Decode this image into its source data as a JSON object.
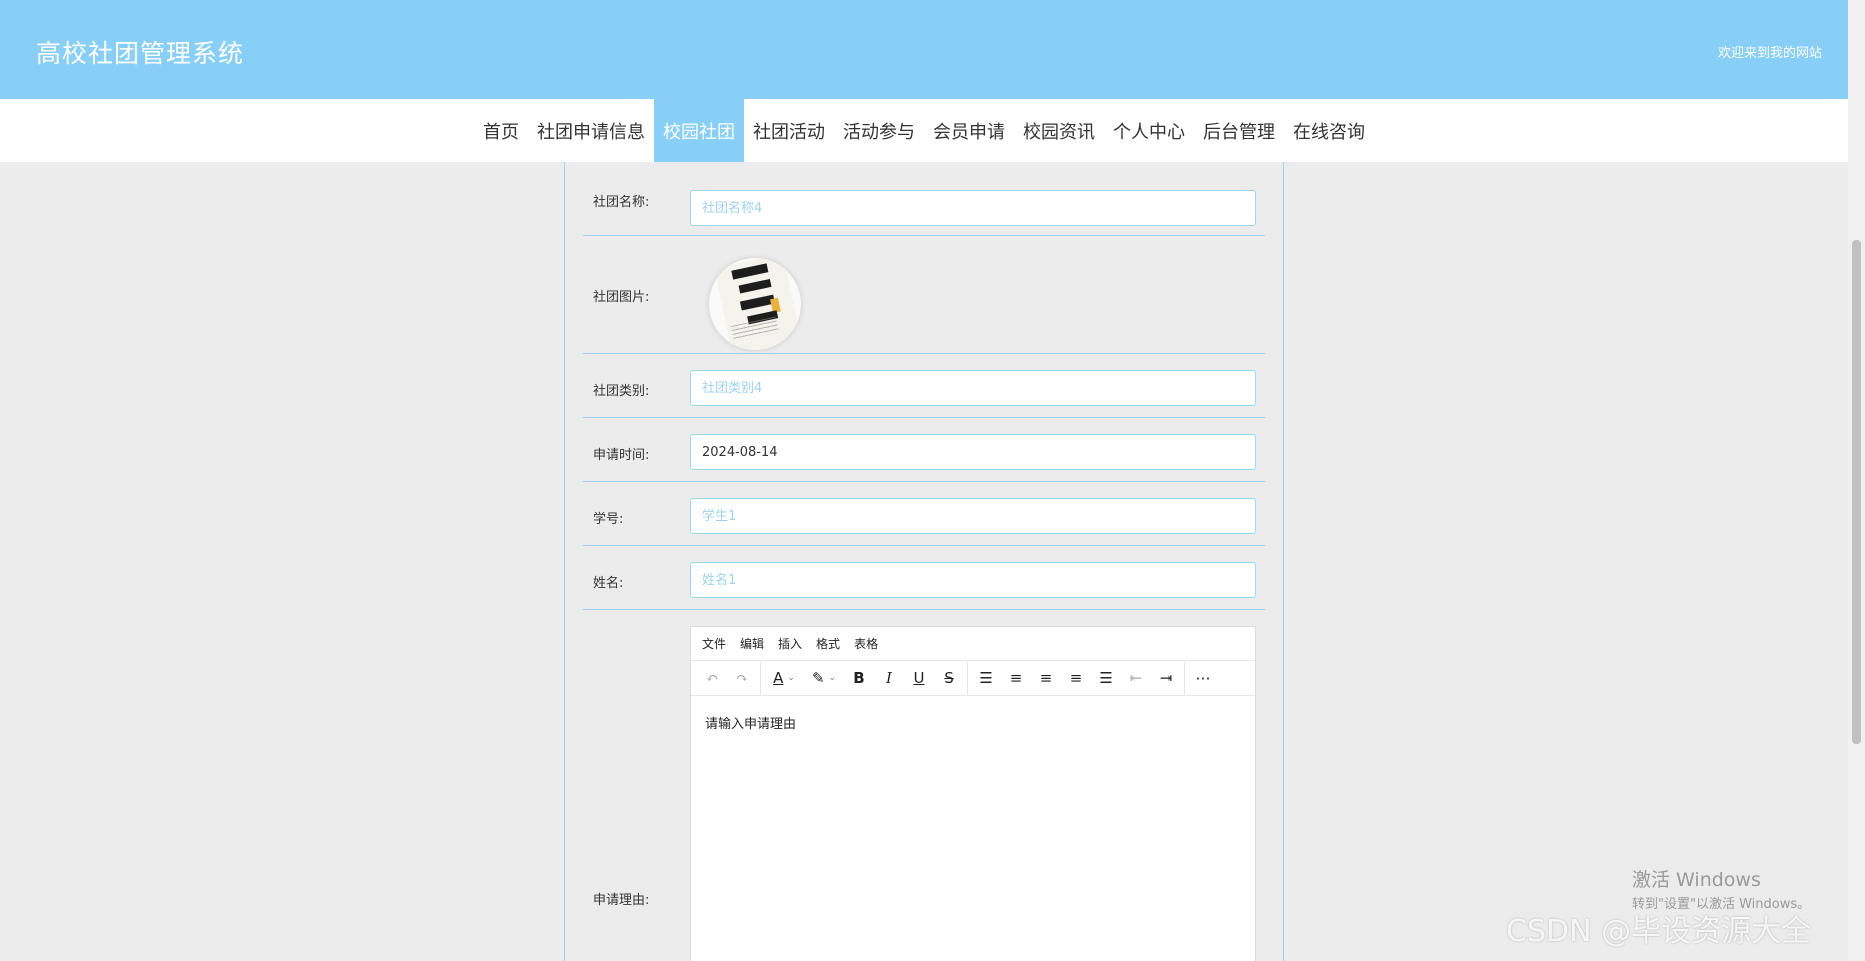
{
  "header": {
    "title": "高校社团管理系统",
    "welcome": "欢迎来到我的网站"
  },
  "nav": {
    "items": [
      "首页",
      "社团申请信息",
      "校园社团",
      "社团活动",
      "活动参与",
      "会员申请",
      "校园资讯",
      "个人中心",
      "后台管理",
      "在线咨询"
    ],
    "active": "校园社团"
  },
  "form": {
    "club_name": {
      "label": "社团名称:",
      "placeholder": "社团名称4"
    },
    "club_image": {
      "label": "社团图片:",
      "alt": "社团招新"
    },
    "club_category": {
      "label": "社团类别:",
      "placeholder": "社团类别4"
    },
    "apply_time": {
      "label": "申请时间:",
      "value": "2024-08-14"
    },
    "student_id": {
      "label": "学号:",
      "placeholder": "学生1"
    },
    "name": {
      "label": "姓名:",
      "placeholder": "姓名1"
    },
    "reason": {
      "label": "申请理由:"
    }
  },
  "editor": {
    "menus": [
      "文件",
      "编辑",
      "插入",
      "格式",
      "表格"
    ],
    "placeholder": "请输入申请理由",
    "tool_icons": [
      "undo-icon",
      "redo-icon",
      "text-color-icon",
      "highlight-icon",
      "bold-icon",
      "italic-icon",
      "underline-icon",
      "strikethrough-icon",
      "line-height-icon",
      "align-left-icon",
      "align-center-icon",
      "align-right-icon",
      "align-justify-icon",
      "outdent-icon",
      "indent-icon",
      "more-icon"
    ]
  },
  "watermarks": {
    "activate_title": "激活 Windows",
    "activate_sub": "转到\"设置\"以激活 Windows。",
    "csdn": "CSDN @毕设资源大全"
  },
  "colors": {
    "primary": "#88cff7",
    "border": "#9ed3ef",
    "background": "#ececec"
  }
}
